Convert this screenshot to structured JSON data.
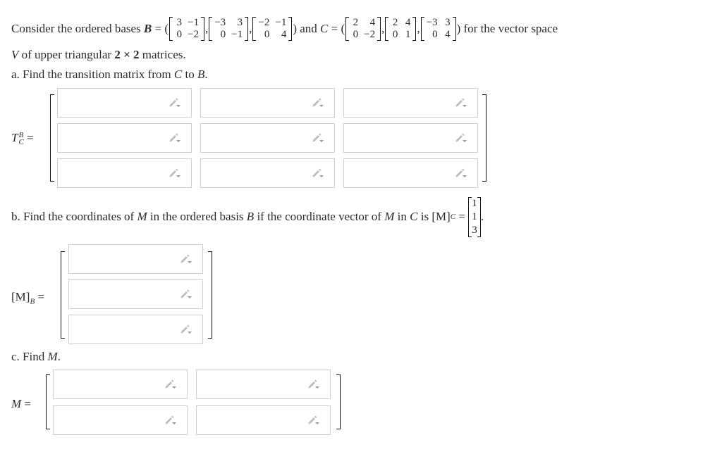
{
  "question": {
    "intro_prefix": "Consider the ordered bases",
    "basis_B_symbol": "B",
    "basis_B": [
      [
        [
          "3",
          "−1"
        ],
        [
          "0",
          "−2"
        ]
      ],
      [
        [
          "−3",
          "3"
        ],
        [
          "0",
          "−1"
        ]
      ],
      [
        [
          "−2",
          "−1"
        ],
        [
          "0",
          "4"
        ]
      ]
    ],
    "and_text": "and",
    "basis_C_symbol": "C",
    "basis_C": [
      [
        [
          "2",
          "4"
        ],
        [
          "0",
          "−2"
        ]
      ],
      [
        [
          "2",
          "4"
        ],
        [
          "0",
          "1"
        ]
      ],
      [
        [
          "−3",
          "3"
        ],
        [
          "0",
          "4"
        ]
      ]
    ],
    "intro_suffix": "for the vector space",
    "line2_V": "V",
    "line2_text": "of upper triangular",
    "line2_dim": "2 × 2",
    "line2_end": "matrices."
  },
  "part_a": {
    "prefix": "a. Find the transition matrix from",
    "from": "C",
    "to_word": "to",
    "to": "B",
    "label_T": "T",
    "label_sup": "B",
    "label_sub": "C",
    "equals": "=",
    "rows": 3,
    "cols": 3,
    "cells": [
      [
        "",
        "",
        ""
      ],
      [
        "",
        "",
        ""
      ],
      [
        "",
        "",
        ""
      ]
    ]
  },
  "part_b": {
    "prefix": "b. Find the coordinates of",
    "M": "M",
    "mid": "in the ordered basis",
    "B": "B",
    "mid2": "if the coordinate vector of",
    "M2": "M",
    "in_word": "in",
    "C": "C",
    "is_word": "is",
    "MC_label": "[M]",
    "MC_sub": "C",
    "equals": "=",
    "vector_MC": [
      "1",
      "1",
      "3"
    ],
    "period": ".",
    "label": "[M]",
    "label_sub": "B",
    "cells": [
      "",
      "",
      ""
    ]
  },
  "part_c": {
    "prefix": "c. Find",
    "M": "M",
    "period": ".",
    "label": "M",
    "equals": "=",
    "cells": [
      [
        "",
        ""
      ],
      [
        "",
        ""
      ]
    ]
  },
  "icons": {
    "cell_icon": "pencil-dropdown-icon"
  }
}
